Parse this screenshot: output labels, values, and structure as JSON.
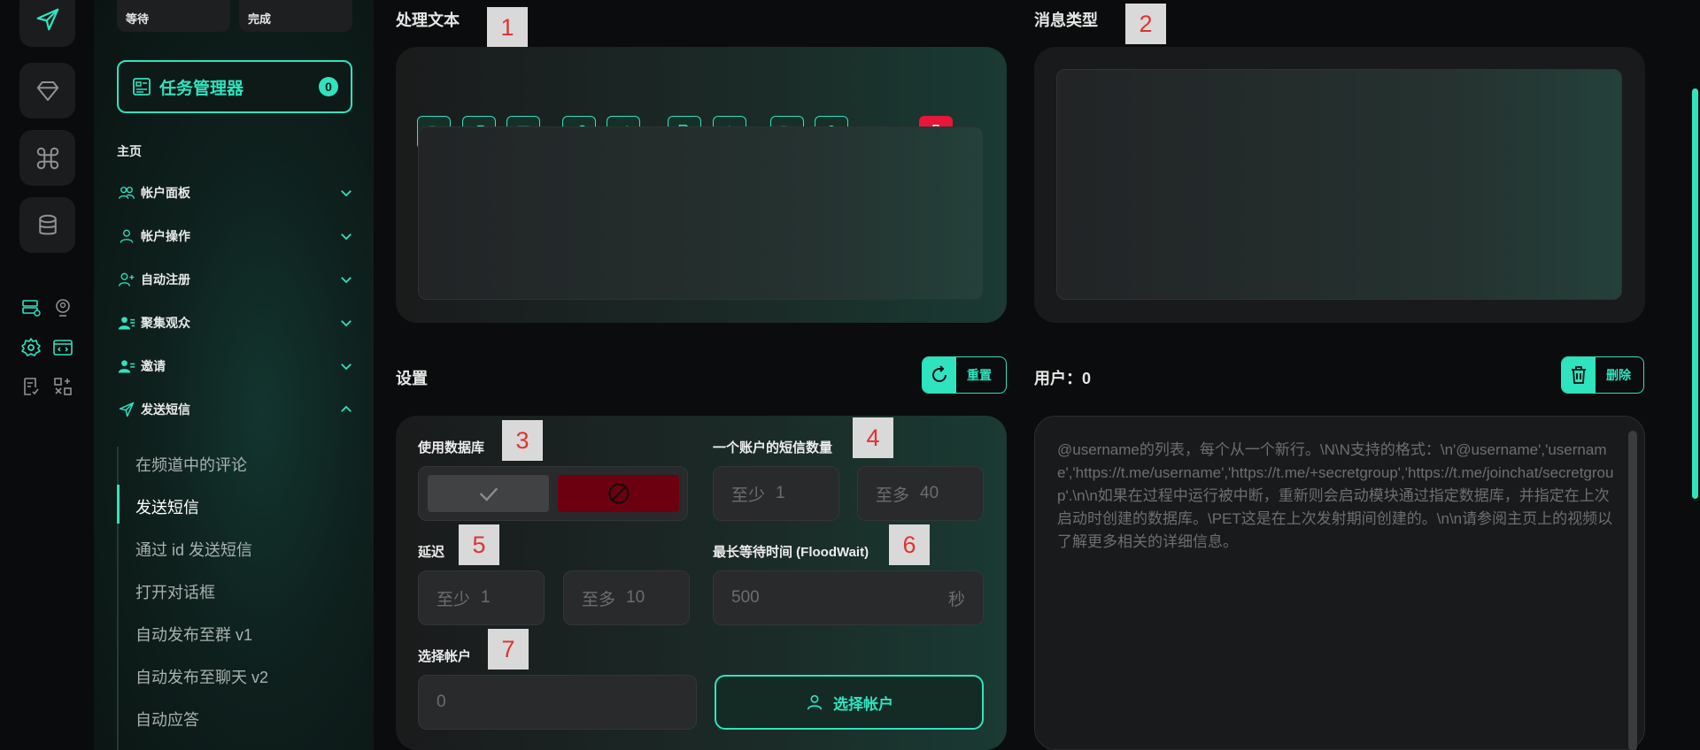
{
  "sidebar": {
    "status_pills": [
      "等待",
      "完成"
    ],
    "task_manager": {
      "label": "任务管理器",
      "count": "0"
    },
    "home": "主页",
    "nav_items": [
      {
        "label": "帐户面板",
        "icon": "users-icon",
        "expanded": false
      },
      {
        "label": "帐户操作",
        "icon": "user-icon",
        "expanded": false
      },
      {
        "label": "自动注册",
        "icon": "user-plus-icon",
        "expanded": false
      },
      {
        "label": "聚集观众",
        "icon": "user-group-icon",
        "expanded": false
      },
      {
        "label": "邀请",
        "icon": "user-invite-icon",
        "expanded": false
      },
      {
        "label": "发送短信",
        "icon": "send-icon",
        "expanded": true
      }
    ],
    "sub_items": [
      "在频道中的评论",
      "发送短信",
      "通过 id 发送短信",
      "打开对话框",
      "自动发布至群 v1",
      "自动发布至聊天 v2",
      "自动应答"
    ],
    "active_sub_item": "发送短信"
  },
  "main": {
    "process_text": {
      "title": "处理文本",
      "tag": "1",
      "toolbar": [
        "bold-icon",
        "italic-icon",
        "text-icon",
        "link-icon",
        "repeat-icon",
        "file-download-icon",
        "robot-icon",
        "text-format-icon",
        "person-icon"
      ],
      "text_value": ""
    },
    "message_type": {
      "title": "消息类型",
      "tag": "2",
      "value": ""
    },
    "settings": {
      "title": "设置",
      "reset_label": "重置",
      "use_database": {
        "label": "使用数据库",
        "tag": "3"
      },
      "messages_per_account": {
        "label": "一个账户的短信数量",
        "tag": "4",
        "min_prefix": "至少",
        "min_value": "1",
        "max_prefix": "至多",
        "max_value": "40"
      },
      "delay": {
        "label": "延迟",
        "tag": "5",
        "min_prefix": "至少",
        "min_value": "1",
        "max_prefix": "至多",
        "max_value": "10"
      },
      "flood_wait": {
        "label": "最长等待时间 (FloodWait)",
        "tag": "6",
        "value": "500",
        "unit": "秒"
      },
      "select_account": {
        "label": "选择帐户",
        "tag": "7",
        "value": "0",
        "button_label": "选择帐户"
      }
    },
    "users": {
      "title": "用户：0",
      "delete_label": "删除",
      "placeholder": "@username的列表，每个从一个新行。\\N\\N支持的格式：\\n'@username','username','https://t.me/username','https://t.me/+secretgroup','https://t.me/joinchat/secretgroup'.\\n\\n如果在过程中运行被中断，重新则会启动模块通过指定数据库，并指定在上次启动时创建的数据库。\\PET这是在上次发射期间创建的。\\n\\n请参阅主页上的视频以了解更多相关的详细信息。"
    }
  },
  "colors": {
    "accent": "#2fe3be",
    "danger": "#e8163a",
    "background": "#0b0c0d"
  }
}
